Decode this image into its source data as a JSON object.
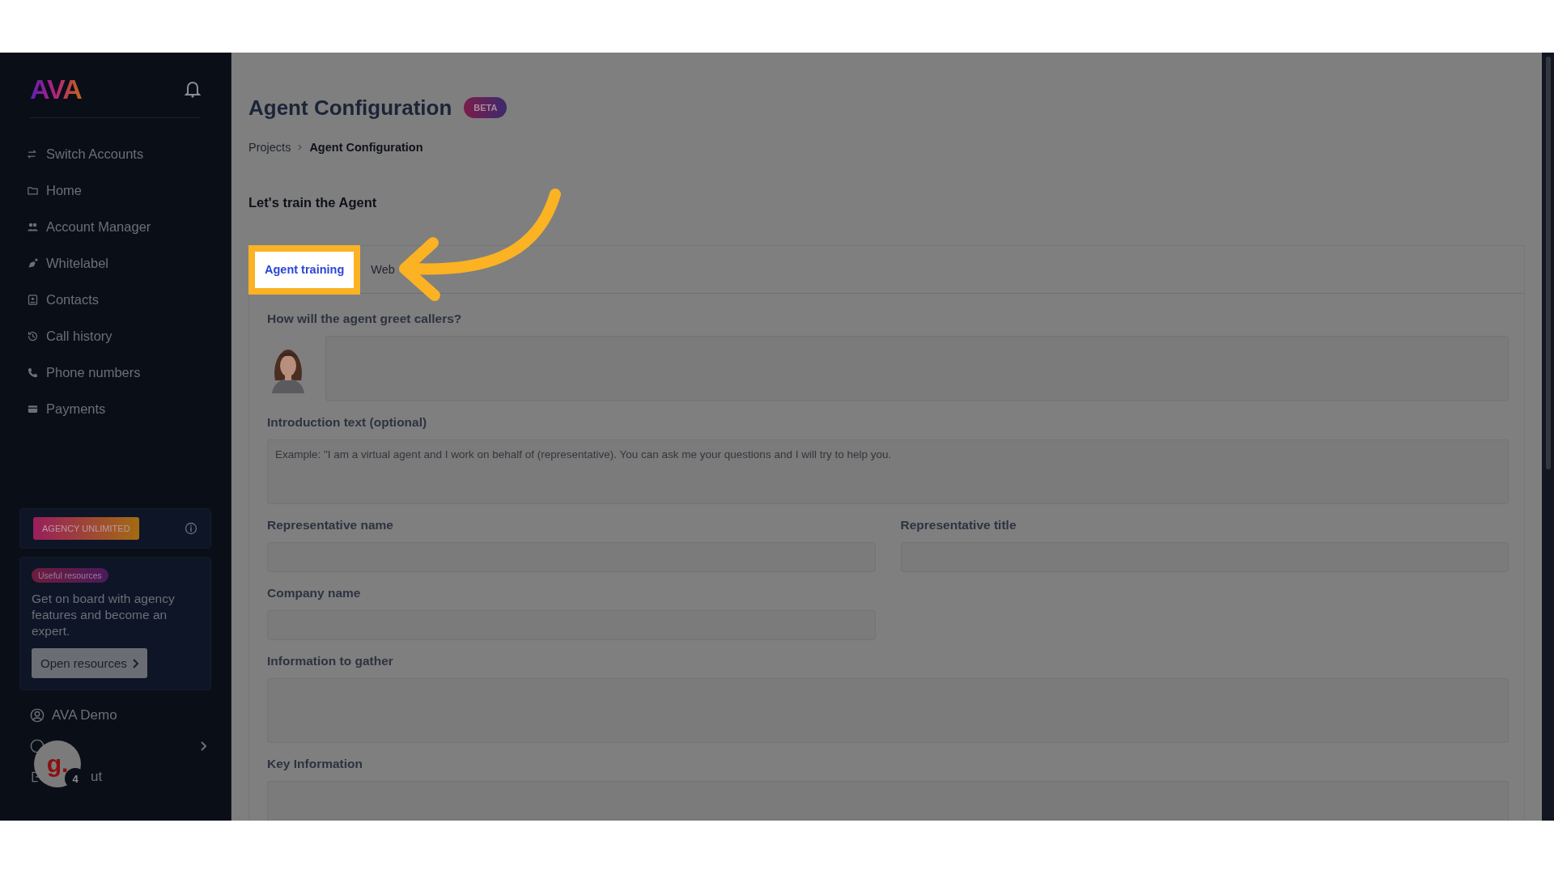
{
  "sidebar": {
    "logo": "AVA",
    "nav_items": [
      {
        "label": "Switch Accounts"
      },
      {
        "label": "Home"
      },
      {
        "label": "Account Manager"
      },
      {
        "label": "Whitelabel"
      },
      {
        "label": "Contacts"
      },
      {
        "label": "Call history"
      },
      {
        "label": "Phone numbers"
      },
      {
        "label": "Payments"
      }
    ],
    "plan_badge": "AGENCY UNLIMITED",
    "resources_card": {
      "tag": "Useful resources",
      "text": "Get on board with agency features and become an expert.",
      "button": "Open resources"
    },
    "account": {
      "label": "AVA Demo"
    },
    "logout": {
      "label": "ut"
    },
    "chat_widget": {
      "label": "g.",
      "badge": "4"
    }
  },
  "page": {
    "title": "Agent Configuration",
    "badge": "BETA",
    "breadcrumb": [
      {
        "label": "Projects",
        "current": false
      },
      {
        "label": "Agent Configuration",
        "current": true
      }
    ],
    "subtitle": "Let's train the Agent",
    "tabs": [
      {
        "label": "Agent training",
        "selected": true
      },
      {
        "label": "Web",
        "selected": false
      }
    ],
    "fields": [
      {
        "kind": "greeting",
        "label": "How will the agent greet callers?"
      },
      {
        "kind": "textarea",
        "label": "Introduction text (optional)",
        "placeholder": "Example: \"I am a virtual agent and I work on behalf of (representative). You can ask me your questions and I will try to help you."
      },
      {
        "kind": "input",
        "label": "Representative name"
      },
      {
        "kind": "input",
        "label": "Representative title"
      },
      {
        "kind": "input",
        "label": "Company name"
      },
      {
        "kind": "textarea",
        "label": "Information to gather"
      },
      {
        "kind": "textarea",
        "label": "Key Information"
      }
    ]
  }
}
